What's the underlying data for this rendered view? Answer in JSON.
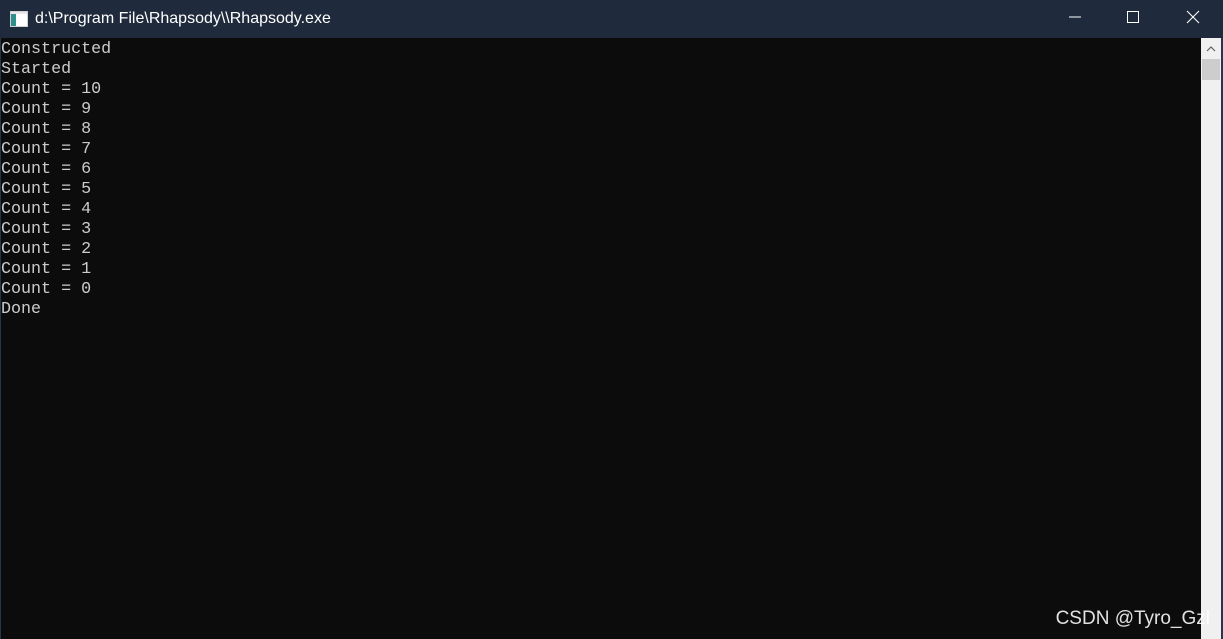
{
  "window": {
    "title": "d:\\Program File\\Rhapsody\\\\Rhapsody.exe",
    "icon": "console-app-icon",
    "controls": {
      "minimize": "minimize-icon",
      "maximize": "maximize-icon",
      "close": "close-icon"
    }
  },
  "console": {
    "lines": [
      "Constructed",
      "Started",
      "Count = 10",
      "Count = 9",
      "Count = 8",
      "Count = 7",
      "Count = 6",
      "Count = 5",
      "Count = 4",
      "Count = 3",
      "Count = 2",
      "Count = 1",
      "Count = 0",
      "Done"
    ]
  },
  "scrollbar": {
    "up_icon": "chevron-up-icon"
  },
  "watermark": "CSDN @Tyro_Gzl",
  "colors": {
    "titlebar": "#1f2b3c",
    "console_background": "#0c0c0c",
    "console_text": "#cccccc",
    "scrollbar_track": "#f0f0f0",
    "scrollbar_thumb": "#cdcdcd"
  }
}
